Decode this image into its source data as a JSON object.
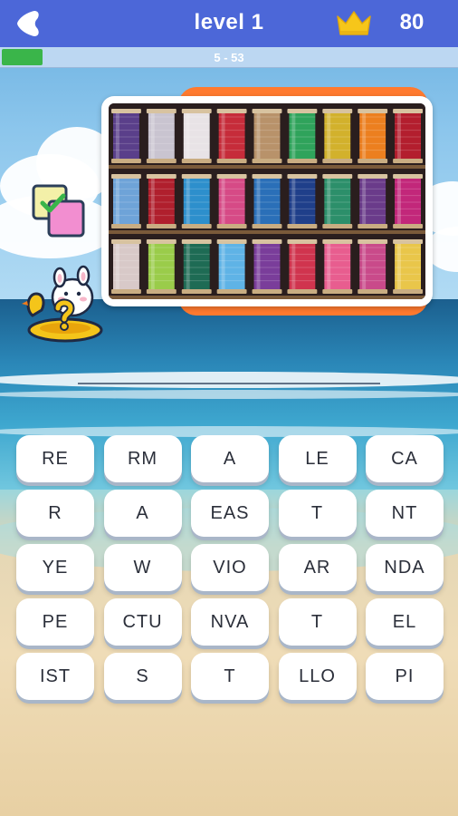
{
  "header": {
    "title": "level 1",
    "coins": "80",
    "progress_text": "5 - 53",
    "progress_fraction": 0.09
  },
  "theme": {
    "bar_color": "#4c67d8",
    "progress_color": "#3ab54a",
    "card_tab_color": "#ff7a2f"
  },
  "icons": {
    "back": "back-arrow-icon",
    "coins": "crown-icon",
    "toggle": "check-squares-icon",
    "hint": "question-mascot-icon"
  },
  "puzzle_image": {
    "spool_colors": [
      [
        "#5a3f8a",
        "#c9c4d0",
        "#e8e3e6",
        "#c62c3a",
        "#b8926a",
        "#2fa35b",
        "#d2b12c",
        "#ec7f1f",
        "#b31e2e"
      ],
      [
        "#6ea3d8",
        "#b01f2d",
        "#2d8fcc",
        "#d64a86",
        "#2a6fb8",
        "#1f3f8a",
        "#2c8f6a",
        "#6a3b8a",
        "#c2277a"
      ],
      [
        "#d8c9c8",
        "#9acc4a",
        "#1e6b54",
        "#5fb3e6",
        "#7a3d9a",
        "#d0344e",
        "#e85d8f",
        "#c94a8a",
        "#e9c64a"
      ]
    ]
  },
  "tiles": [
    [
      "RE",
      "RM",
      "A",
      "LE",
      "CA"
    ],
    [
      "R",
      "A",
      "EAS",
      "T",
      "NT"
    ],
    [
      "YE",
      "W",
      "VIO",
      "AR",
      "NDA"
    ],
    [
      "PE",
      "CTU",
      "NVA",
      "T",
      "EL"
    ],
    [
      "IST",
      "S",
      "T",
      "LLO",
      "PI"
    ]
  ]
}
